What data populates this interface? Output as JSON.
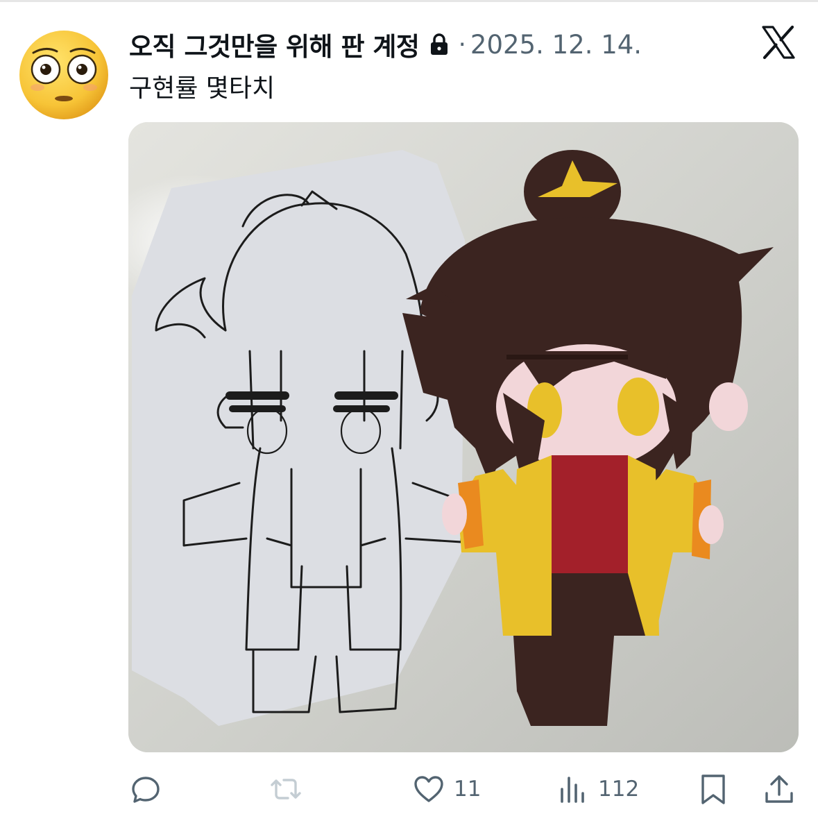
{
  "post": {
    "author_name": "오직 그것만을 위해 판 계정",
    "separator": "·",
    "date": "2025. 12. 14.",
    "text": "구현률 몇타치",
    "avatar_icon": "flushed-face-emoji",
    "locked_icon": "lock-icon",
    "platform_icon": "x-logo-icon"
  },
  "media": {
    "description_icon": "photo-sketch-and-felt-plush-doll"
  },
  "actions": {
    "reply": {
      "icon": "reply-icon",
      "count": ""
    },
    "repost": {
      "icon": "repost-icon",
      "count": "",
      "state": "disabled"
    },
    "like": {
      "icon": "heart-icon",
      "count": "11"
    },
    "views": {
      "icon": "views-icon",
      "count": "112"
    },
    "bookmark": {
      "icon": "bookmark-icon",
      "count": ""
    },
    "share": {
      "icon": "share-icon",
      "count": ""
    }
  },
  "colors": {
    "text_primary": "#0f1419",
    "text_secondary": "#536471",
    "repost_disabled": "#c4cdd3",
    "felt_hair": "#3b2420",
    "felt_jacket": "#e8c02a",
    "felt_shirt": "#a3202a",
    "felt_cuff": "#ea8a1f",
    "felt_skin": "#f2d6d9"
  }
}
